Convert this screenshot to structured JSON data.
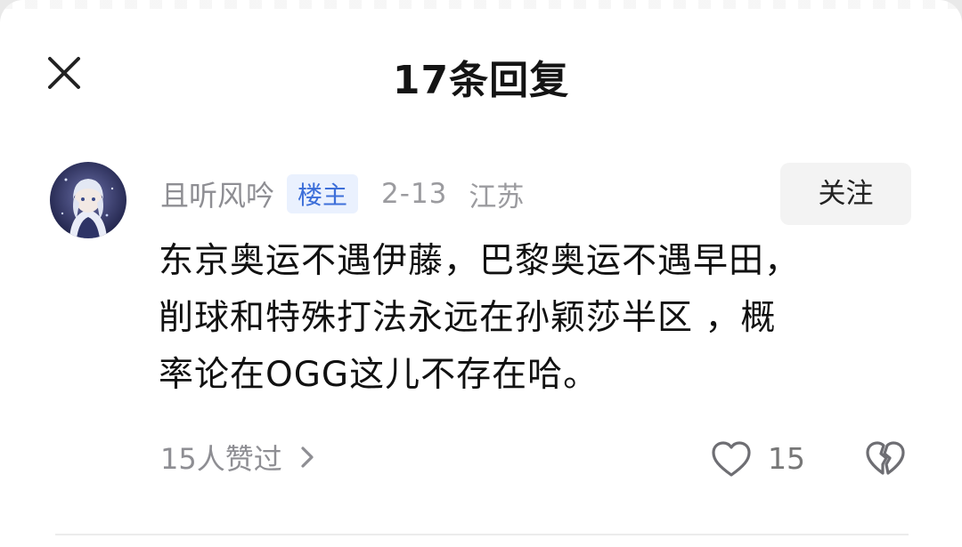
{
  "header": {
    "title": "17条回复",
    "close_icon": "close-icon"
  },
  "comment": {
    "avatar_icon": "anime-girl-avatar",
    "username": "且听风吟",
    "badge": "楼主",
    "date": "2-13",
    "location": "江苏",
    "follow_label": "关注",
    "lines": [
      "东京奥运不遇伊藤，巴黎奥运不遇早田，",
      "削球和特殊打法永远在孙颖莎半区 ，概",
      "率论在OGG这儿不存在哈。"
    ],
    "likes_text": "15人赞过",
    "like_count": "15",
    "icons": {
      "chevron": "chevron-right-icon",
      "like": "heart-outline-icon",
      "dislike": "broken-heart-icon"
    }
  },
  "colors": {
    "badge_text": "#3d6fd9",
    "badge_bg": "#eaf1fe",
    "muted": "#8e8e93",
    "text": "#111111"
  }
}
